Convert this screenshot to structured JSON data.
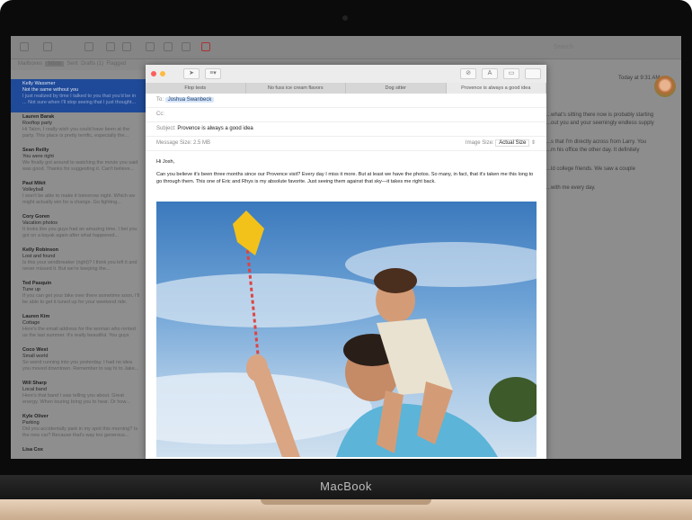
{
  "device": {
    "brand": "MacBook"
  },
  "toolbar": {
    "search_placeholder": "Search"
  },
  "filter": {
    "mailboxes": "Mailboxes",
    "tabs": [
      "Inbox",
      "Sent",
      "Drafts (1)",
      "Flagged"
    ]
  },
  "messages": [
    {
      "from": "Kelly Wassmer",
      "subject": "Not the same without you",
      "preview": "I just realized by time I talked to you that you'd be in ... Not sure when I'll stop seeing that I just thought...",
      "selected": true
    },
    {
      "from": "Lauren Barak",
      "subject": "Rooftop party",
      "preview": "Hi Talon, I really wish you could have been at the party. This place is pretty terrific, especially the..."
    },
    {
      "from": "Sean Reilly",
      "subject": "You were right",
      "preview": "We finally got around to watching the movie you said was good. Thanks for suggesting it. Can't believe..."
    },
    {
      "from": "Paul Mikit",
      "subject": "Volleyball",
      "preview": "I won't be able to make it tomorrow night. Which we might actually win for a change. Go fighting..."
    },
    {
      "from": "Cory Goren",
      "subject": "Vacation photos",
      "preview": "It looks like you guys had an amazing time. I bet you got on a kayak again after what happened..."
    },
    {
      "from": "Kelly Robinson",
      "subject": "Lost and found",
      "preview": "Is this your windbreaker (right)? I think you left it and never missed it. But we're keeping the..."
    },
    {
      "from": "Ted Pasquin",
      "subject": "Tune up",
      "preview": "If you can get your bike over there sometime soon, I'll be able to get it tuned up for your weekend ride."
    },
    {
      "from": "Lauren Kim",
      "subject": "Cottage",
      "preview": "Here's the email address for the woman who rented us the last summer. It's really beautiful. You guys will..."
    },
    {
      "from": "Coco West",
      "subject": "Small world",
      "preview": "So weird running into you yesterday. I had no idea you moved downtown. Remember to say hi to Jake..."
    },
    {
      "from": "Will Sharp",
      "subject": "Local band",
      "preview": "Here's that band I was telling you about. Great energy. When touring bring you to hear. Or how..."
    },
    {
      "from": "Kyle Oliver",
      "subject": "Parking",
      "preview": "Did you accidentally park in my spot this morning? Is the new car? Because that's way too generous..."
    },
    {
      "from": "Lisa Cox",
      "subject": "",
      "preview": ""
    }
  ],
  "reader": {
    "timestamp": "Today at 9:31 AM",
    "lines": [
      "...what's sitting there now is probably starting",
      "...out you and your seemingly endless supply",
      "...s that I'm directly across from Larry. You",
      "...m his office the other day. It definitely",
      "...ld college friends. We saw a couple",
      "...with me every day."
    ]
  },
  "compose": {
    "tabs": [
      "Flop tests",
      "No fuss ice cream flavors",
      "Dog sitter",
      "Provence is always a good idea"
    ],
    "active_tab": 3,
    "to_label": "To:",
    "to": "Joshua Swanbeck",
    "cc_label": "Cc:",
    "subject_label": "Subject:",
    "subject": "Provence is always a good idea",
    "size_label": "Message Size:",
    "size": "2.5 MB",
    "image_size_label": "Image Size:",
    "image_size": "Actual Size",
    "greeting": "Hi Josh,",
    "body": "Can you believe it's been three months since our Provence visit? Every day I miss it more. But at least we have the photos. So many, in fact, that it's taken me this long to go through them. This one of Eric and Rhys is my absolute favorite. Just seeing them against that sky—it takes me right back."
  },
  "colors": {
    "selection": "#1f4a99",
    "close": "#fc605c",
    "minimize": "#fdbc40"
  }
}
